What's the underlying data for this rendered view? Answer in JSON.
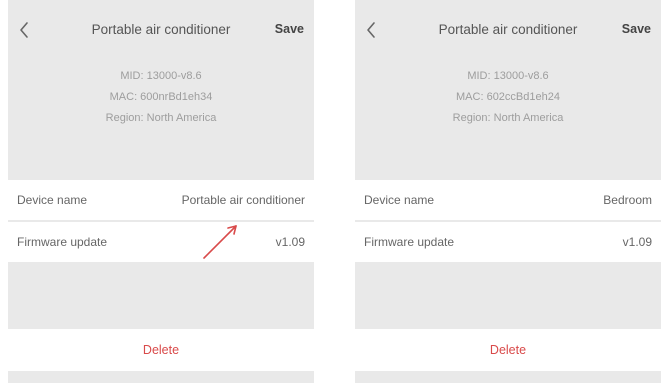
{
  "screens": [
    {
      "header": {
        "title": "Portable air conditioner",
        "save_label": "Save"
      },
      "info": {
        "mid": "MID: 13000-v8.6",
        "mac": "MAC: 600nrBd1eh34",
        "region": "Region: North America"
      },
      "device_name": {
        "label": "Device name",
        "value": "Portable air conditioner"
      },
      "firmware": {
        "label": "Firmware update",
        "value": "v1.09"
      },
      "delete_label": "Delete"
    },
    {
      "header": {
        "title": "Portable air conditioner",
        "save_label": "Save"
      },
      "info": {
        "mid": "MID: 13000-v8.6",
        "mac": "MAC: 602ccBd1eh24",
        "region": "Region: North America"
      },
      "device_name": {
        "label": "Device name",
        "value": "Bedroom"
      },
      "firmware": {
        "label": "Firmware update",
        "value": "v1.09"
      },
      "delete_label": "Delete"
    }
  ],
  "colors": {
    "background": "#e9e9e9",
    "row_background": "#ffffff",
    "delete_text": "#d94a4a",
    "annotation_arrow": "#d94a4a"
  }
}
